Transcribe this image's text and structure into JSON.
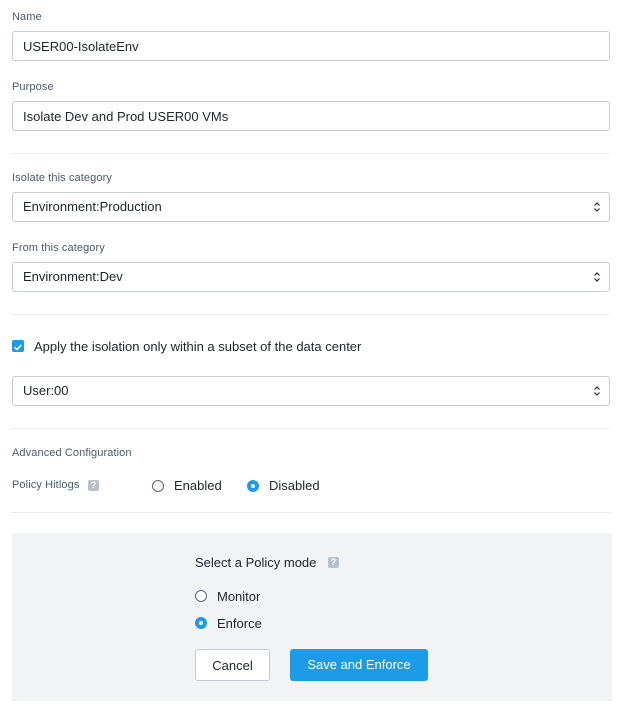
{
  "form": {
    "name": {
      "label": "Name",
      "value": "USER00-IsolateEnv"
    },
    "purpose": {
      "label": "Purpose",
      "value": "Isolate Dev and Prod USER00 VMs"
    },
    "isolate_category": {
      "label": "Isolate this category",
      "value": "Environment:Production"
    },
    "from_category": {
      "label": "From this category",
      "value": "Environment:Dev"
    },
    "subset": {
      "checkbox_label": "Apply the isolation only within a subset of the data center",
      "checked": true,
      "value": "User:00"
    },
    "advanced": {
      "heading": "Advanced Configuration",
      "hitlogs_label": "Policy Hitlogs",
      "help_glyph": "?",
      "options": [
        "Enabled",
        "Disabled"
      ],
      "selected": "Disabled"
    }
  },
  "policy_mode": {
    "title": "Select a Policy mode",
    "help_glyph": "?",
    "options": [
      "Monitor",
      "Enforce"
    ],
    "selected": "Enforce",
    "cancel_label": "Cancel",
    "submit_label": "Save and Enforce"
  },
  "colors": {
    "accent": "#1b9be8",
    "border": "#c5ccd6",
    "panel_bg": "#f2f3f5",
    "label": "#4a5a70"
  },
  "icons": {
    "select_arrow": "updown-chevron-icon",
    "help": "help-icon",
    "check": "checkmark-icon"
  }
}
